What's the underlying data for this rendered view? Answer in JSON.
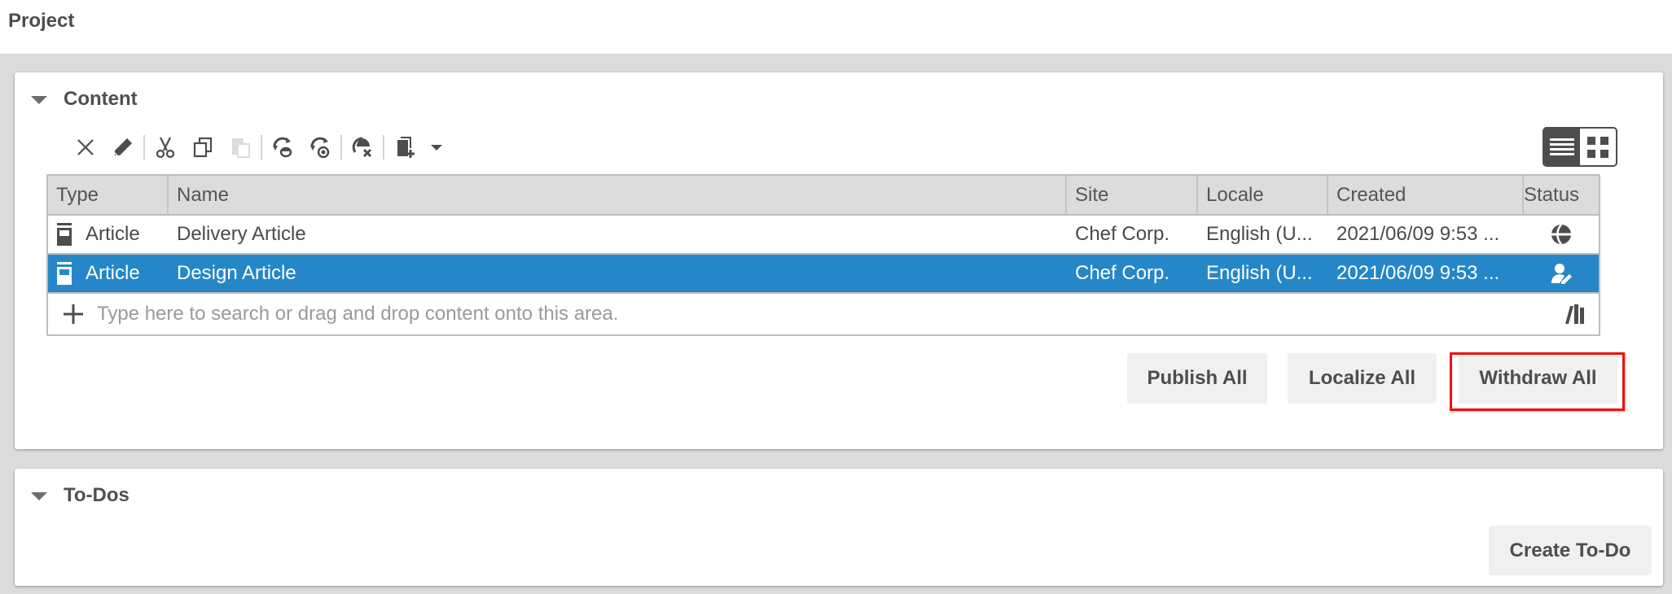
{
  "header": {
    "title": "Project"
  },
  "content_panel": {
    "title": "Content",
    "toolbar": [
      {
        "name": "close-icon",
        "label": "Close"
      },
      {
        "name": "pencil-icon",
        "label": "Edit"
      },
      {
        "name": "scissors-icon",
        "label": "Cut"
      },
      {
        "name": "copy-icon",
        "label": "Copy"
      },
      {
        "name": "paste-icon",
        "label": "Paste",
        "disabled": true
      },
      {
        "name": "sync-icon",
        "label": "Synchronize"
      },
      {
        "name": "sync-check-icon",
        "label": "Synchronize and check"
      },
      {
        "name": "globe-x-icon",
        "label": "Withdraw"
      },
      {
        "name": "new-document-icon",
        "label": "Create"
      }
    ],
    "view_toggle": {
      "list": "list-view-icon",
      "grid": "grid-view-icon",
      "active": "list"
    },
    "table": {
      "columns": [
        "Type",
        "Name",
        "Site",
        "Locale",
        "Created",
        "Status"
      ],
      "rows": [
        {
          "type": "Article",
          "name": "Delivery Article",
          "site": "Chef Corp.",
          "locale": "English (U...",
          "created": "2021/06/09 9:53 ...",
          "status_icon": "published-globe-icon",
          "selected": false
        },
        {
          "type": "Article",
          "name": "Design Article",
          "site": "Chef Corp.",
          "locale": "English (U...",
          "created": "2021/06/09 9:53 ...",
          "status_icon": "user-edit-icon",
          "selected": true
        }
      ],
      "add_placeholder": "Type here to search or drag and drop content onto this area."
    },
    "buttons": {
      "publish_all": "Publish All",
      "localize_all": "Localize All",
      "withdraw_all": "Withdraw All"
    },
    "highlight_color": "#ee1111",
    "selection_color": "#2587c8"
  },
  "todos_panel": {
    "title": "To-Dos",
    "create_button": "Create To-Do"
  }
}
